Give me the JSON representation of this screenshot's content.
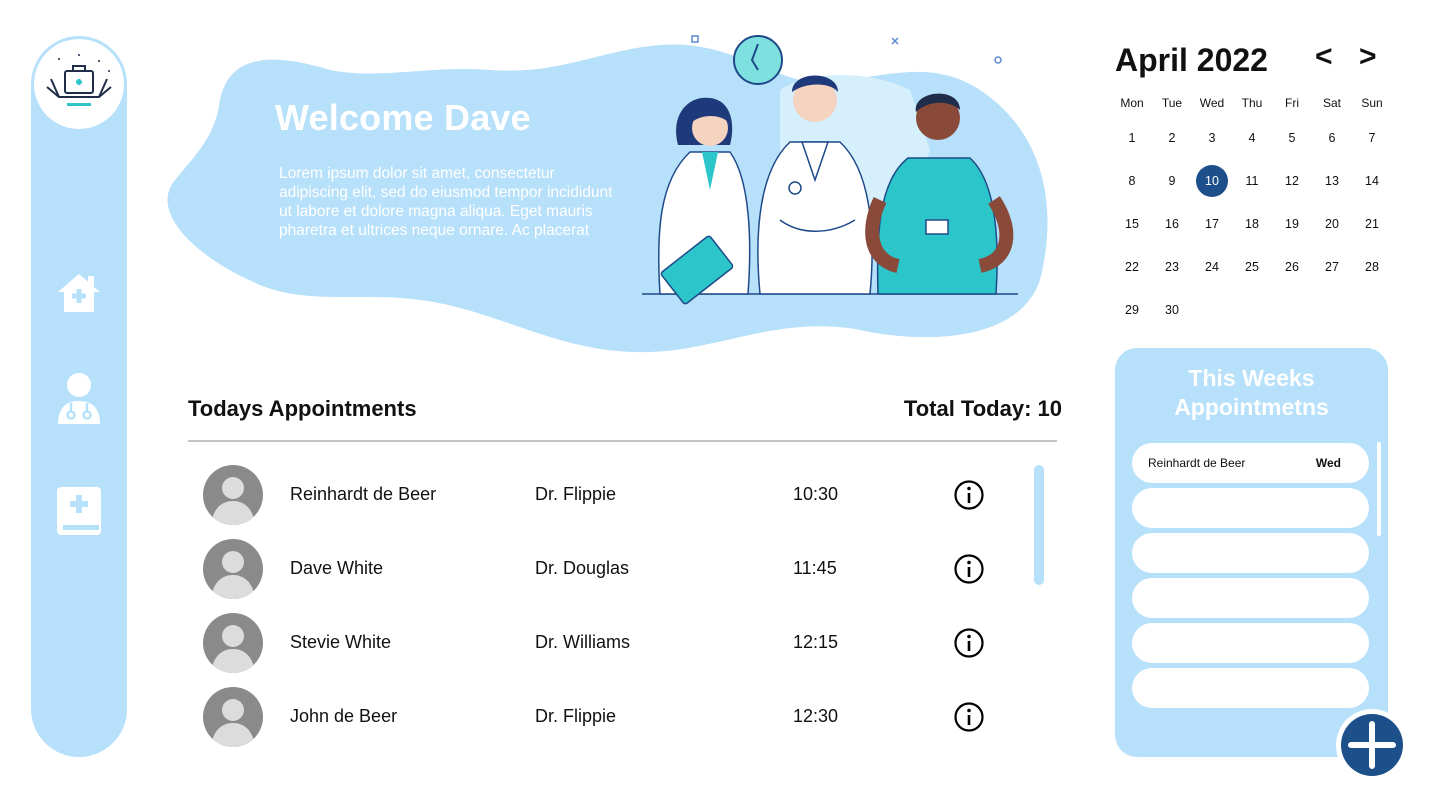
{
  "hero": {
    "welcome": "Welcome Dave",
    "body": "Lorem ipsum dolor sit amet, consectetur adipiscing elit, sed do eiusmod tempor incididunt ut labore et dolore magna aliqua. Eget mauris pharetra et ultrices neque ornare. Ac placerat"
  },
  "sidebar": {
    "items": [
      {
        "icon": "home-medical-icon"
      },
      {
        "icon": "doctor-icon"
      },
      {
        "icon": "medical-book-icon"
      }
    ]
  },
  "appointments": {
    "title": "Todays Appointments",
    "total": "Total Today: 10",
    "rows": [
      {
        "patient": "Reinhardt de Beer",
        "doctor": "Dr. Flippie",
        "time": "10:30"
      },
      {
        "patient": "Dave White",
        "doctor": "Dr. Douglas",
        "time": "11:45"
      },
      {
        "patient": "Stevie White",
        "doctor": "Dr. Williams",
        "time": "12:15"
      },
      {
        "patient": "John de Beer",
        "doctor": "Dr. Flippie",
        "time": "12:30"
      }
    ]
  },
  "calendar": {
    "title": "April 2022",
    "prev": "<",
    "next": ">",
    "weekdays": [
      "Mon",
      "Tue",
      "Wed",
      "Thu",
      "Fri",
      "Sat",
      "Sun"
    ],
    "days": [
      "1",
      "2",
      "3",
      "4",
      "5",
      "6",
      "7",
      "8",
      "9",
      "10",
      "11",
      "12",
      "13",
      "14",
      "15",
      "16",
      "17",
      "18",
      "19",
      "20",
      "21",
      "22",
      "23",
      "24",
      "25",
      "26",
      "27",
      "28",
      "29",
      "30"
    ],
    "selected": "10"
  },
  "week": {
    "title": "This Weeks Appointmetns",
    "items": [
      {
        "name": "Reinhardt de Beer",
        "day": "Wed"
      },
      {
        "name": "",
        "day": ""
      },
      {
        "name": "",
        "day": ""
      },
      {
        "name": "",
        "day": ""
      },
      {
        "name": "",
        "day": ""
      },
      {
        "name": "",
        "day": ""
      }
    ]
  },
  "colors": {
    "accent": "#b7e0fb",
    "primary": "#1d4f8a",
    "teal": "#2cc5c9"
  }
}
